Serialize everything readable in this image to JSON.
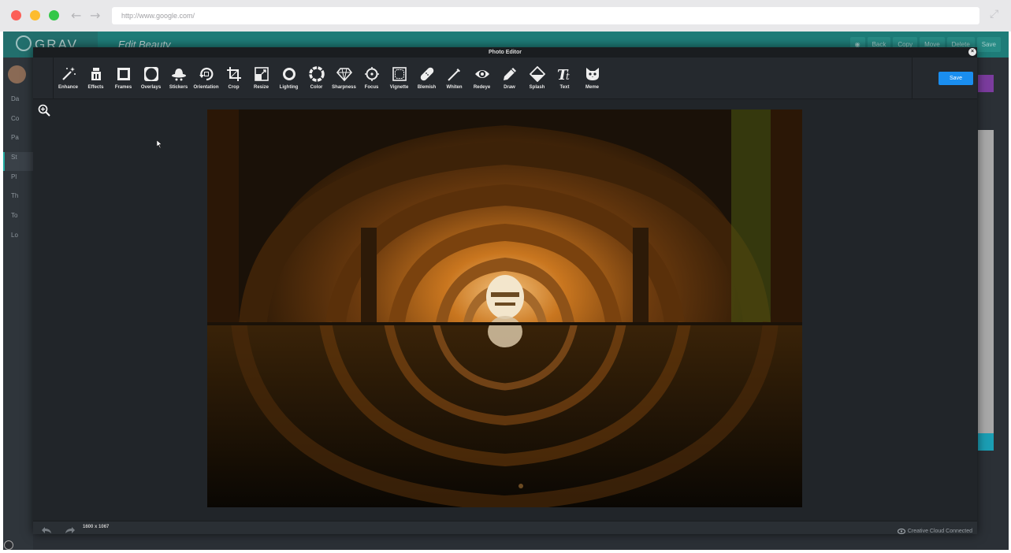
{
  "browser": {
    "url": "http://www.google.com/"
  },
  "admin": {
    "logo_text": "GRAV",
    "page_title": "Edit Beauty",
    "header_buttons": [
      "Back",
      "Copy",
      "Move",
      "Delete",
      "Save"
    ],
    "sidebar_items": [
      "Da",
      "Co",
      "Pa",
      "St",
      "Pl",
      "Th",
      "To",
      "Lo"
    ]
  },
  "editor": {
    "title": "Photo Editor",
    "tools": [
      {
        "label": "Enhance",
        "icon": "magic-wand-icon"
      },
      {
        "label": "Effects",
        "icon": "effects-icon"
      },
      {
        "label": "Frames",
        "icon": "frame-icon"
      },
      {
        "label": "Overlays",
        "icon": "overlay-icon"
      },
      {
        "label": "Stickers",
        "icon": "hat-icon"
      },
      {
        "label": "Orientation",
        "icon": "rotate-icon"
      },
      {
        "label": "Crop",
        "icon": "crop-icon"
      },
      {
        "label": "Resize",
        "icon": "resize-icon"
      },
      {
        "label": "Lighting",
        "icon": "sun-icon"
      },
      {
        "label": "Color",
        "icon": "color-wheel-icon"
      },
      {
        "label": "Sharpness",
        "icon": "diamond-icon"
      },
      {
        "label": "Focus",
        "icon": "focus-icon"
      },
      {
        "label": "Vignette",
        "icon": "vignette-icon"
      },
      {
        "label": "Blemish",
        "icon": "bandage-icon"
      },
      {
        "label": "Whiten",
        "icon": "wand-icon"
      },
      {
        "label": "Redeye",
        "icon": "eye-icon"
      },
      {
        "label": "Draw",
        "icon": "pencil-icon"
      },
      {
        "label": "Splash",
        "icon": "bucket-icon"
      },
      {
        "label": "Text",
        "icon": "text-icon"
      },
      {
        "label": "Meme",
        "icon": "cat-face-icon"
      }
    ],
    "save_label": "Save",
    "image_dimensions": "1600 x 1067",
    "status": "Creative Cloud Connected"
  },
  "colors": {
    "accent": "#1a8ef0",
    "admin_header": "#1e7c78",
    "modal_bg": "#212529"
  }
}
